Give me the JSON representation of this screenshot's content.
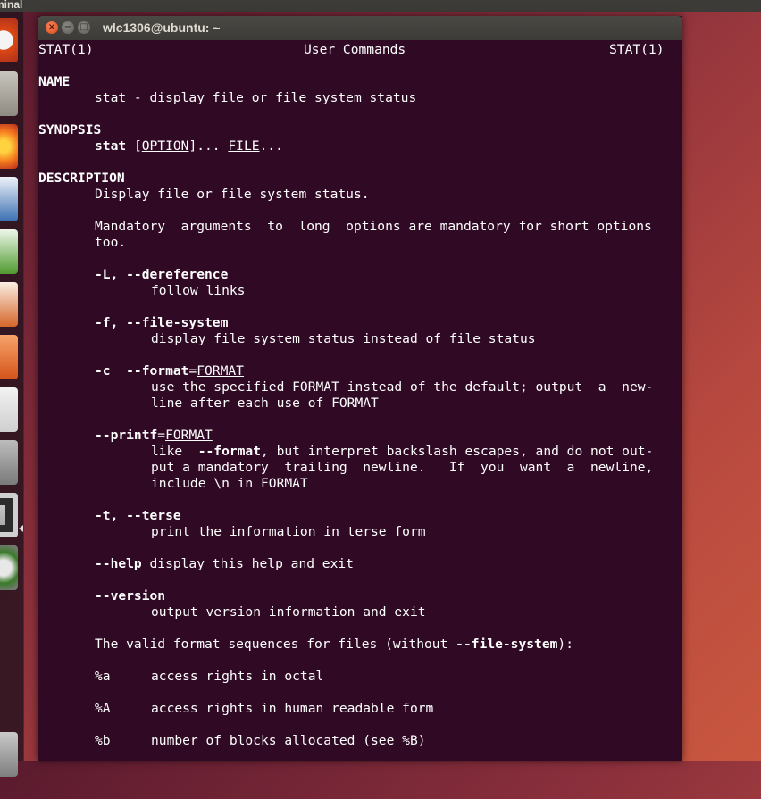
{
  "top_panel": {
    "app_name": "minal"
  },
  "window": {
    "title": "wlc1306@ubuntu: ~"
  },
  "launcher": {
    "icons": [
      "ubuntu-dash-icon",
      "files-icon",
      "firefox-icon",
      "writer-icon",
      "calc-icon",
      "impress-icon",
      "software-center-icon",
      "amazon-icon",
      "system-settings-icon",
      "terminal-icon",
      "update-icon",
      "trash-icon"
    ]
  },
  "man": {
    "header_left": "STAT(1)",
    "header_center": "User Commands",
    "header_right": "STAT(1)",
    "name_heading": "NAME",
    "name_text": "stat - display file or file system status",
    "synopsis_heading": "SYNOPSIS",
    "synopsis_cmd": "stat",
    "synopsis_sp1": " [",
    "synopsis_option": "OPTION",
    "synopsis_sp2": "]... ",
    "synopsis_file": "FILE",
    "synopsis_end": "...",
    "description_heading": "DESCRIPTION",
    "desc_line1": "Display file or file system status.",
    "desc_mandatory1": "Mandatory  arguments  to  long  options are mandatory for short options",
    "desc_mandatory2": "too.",
    "opt_L": "-L, --dereference",
    "opt_L_desc": "follow links",
    "opt_f": "-f, --file-system",
    "opt_f_desc": "display file system status instead of file status",
    "opt_c_flag": "-c  --format",
    "opt_c_eq": "=",
    "opt_c_arg": "FORMAT",
    "opt_c_desc1": "use the specified FORMAT instead of the default; output  a  new-",
    "opt_c_desc2": "line after each use of FORMAT",
    "opt_printf_flag": "--printf",
    "opt_printf_eq": "=",
    "opt_printf_arg": "FORMAT",
    "opt_printf_d1a": "like  ",
    "opt_printf_d1b": "--format",
    "opt_printf_d1c": ", but interpret backslash escapes, and do not out-",
    "opt_printf_d2": "put a mandatory  trailing  newline.   If  you  want  a  newline,",
    "opt_printf_d3": "include \\n in FORMAT",
    "opt_t": "-t, --terse",
    "opt_t_desc": "print the information in terse form",
    "opt_help": "--help",
    "opt_help_desc": " display this help and exit",
    "opt_version": "--version",
    "opt_version_desc": "output version information and exit",
    "valid_a": "The valid format sequences for files (without ",
    "valid_b": "--file-system",
    "valid_c": "):",
    "seq_a_code": "%a",
    "seq_a_desc": "access rights in octal",
    "seq_A_code": "%A",
    "seq_A_desc": "access rights in human readable form",
    "seq_b_code": "%b",
    "seq_b_desc": "number of blocks allocated (see %B)"
  }
}
